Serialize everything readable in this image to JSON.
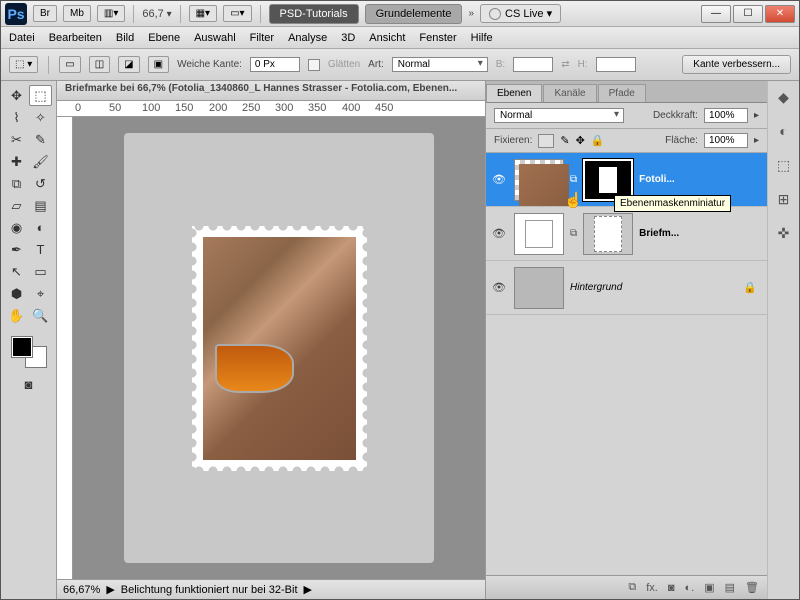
{
  "titlebar": {
    "br": "Br",
    "mb": "Mb",
    "zoom": "66,7",
    "psd_tut": "PSD-Tutorials",
    "grund": "Grundelemente",
    "chev": "»",
    "cslive": "CS Live ▾"
  },
  "menu": {
    "datei": "Datei",
    "bearbeiten": "Bearbeiten",
    "bild": "Bild",
    "ebene": "Ebene",
    "auswahl": "Auswahl",
    "filter": "Filter",
    "analyse": "Analyse",
    "d3": "3D",
    "ansicht": "Ansicht",
    "fenster": "Fenster",
    "hilfe": "Hilfe"
  },
  "opt": {
    "weiche": "Weiche Kante:",
    "px": "0 Px",
    "glatten": "Glätten",
    "art": "Art:",
    "normal": "Normal",
    "b": "B:",
    "h": "H:",
    "verbessern": "Kante verbessern..."
  },
  "doc": {
    "title": "Briefmarke bei 66,7% (Fotolia_1340860_L Hannes Strasser - Fotolia.com, Ebenen..."
  },
  "ruler": {
    "m0": "0",
    "m50": "50",
    "m100": "100",
    "m150": "150",
    "m200": "200",
    "m250": "250",
    "m300": "300",
    "m350": "350",
    "m400": "400",
    "m450": "450"
  },
  "status": {
    "zoom": "66,67%",
    "msg": "Belichtung funktioniert nur bei 32-Bit",
    "tri": "▶"
  },
  "panel": {
    "tabs": {
      "ebenen": "Ebenen",
      "kanale": "Kanäle",
      "pfade": "Pfade"
    },
    "mode": "Normal",
    "deck": "Deckkraft:",
    "deckv": "100%",
    "fix": "Fixieren:",
    "flache": "Fläche:",
    "flachev": "100%",
    "l1": "Fotoli...",
    "l2": "Briefm...",
    "l3": "Hintergrund",
    "tooltip": "Ebenenmaskenminiatur"
  }
}
